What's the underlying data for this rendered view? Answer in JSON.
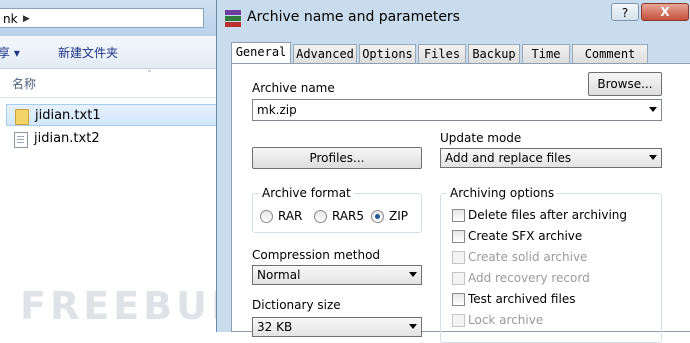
{
  "explorer": {
    "path_text": "nk",
    "toolbar": {
      "organize_label": "享 ▾",
      "new_folder_label": "新建文件夹"
    },
    "column_header": "名称",
    "files": [
      {
        "name": "jidian.txt1",
        "icon": "folder-icon",
        "selected": true
      },
      {
        "name": "jidian.txt2",
        "icon": "text-file-icon",
        "selected": false
      }
    ],
    "watermark": "FREEBUF"
  },
  "dialog": {
    "title": "Archive name and parameters",
    "help_label": "?",
    "close_label": "X",
    "tabs": [
      "General",
      "Advanced",
      "Options",
      "Files",
      "Backup",
      "Time",
      "Comment"
    ],
    "active_tab": "General",
    "archive_name_label": "Archive name",
    "browse_label": "Browse...",
    "archive_name_value": "mk.zip",
    "update_mode_label": "Update mode",
    "update_mode_value": "Add and replace files",
    "profiles_label": "Profiles...",
    "archive_format": {
      "title": "Archive format",
      "options": [
        "RAR",
        "RAR5",
        "ZIP"
      ],
      "selected": "ZIP"
    },
    "compression_method_label": "Compression method",
    "compression_method_value": "Normal",
    "dictionary_size_label": "Dictionary size",
    "dictionary_size_value": "32 KB",
    "archiving_options": {
      "title": "Archiving options",
      "items": [
        {
          "label": "Delete files after archiving",
          "enabled": true,
          "checked": false
        },
        {
          "label": "Create SFX archive",
          "enabled": true,
          "checked": false
        },
        {
          "label": "Create solid archive",
          "enabled": false,
          "checked": false
        },
        {
          "label": "Add recovery record",
          "enabled": false,
          "checked": false
        },
        {
          "label": "Test archived files",
          "enabled": true,
          "checked": false
        },
        {
          "label": "Lock archive",
          "enabled": false,
          "checked": false
        }
      ]
    }
  },
  "colors": {
    "dialog_frame": "#c9dced",
    "close_button": "#c4503b",
    "selection": "#d1e7fb",
    "radio_dot": "#1f5a9a"
  }
}
